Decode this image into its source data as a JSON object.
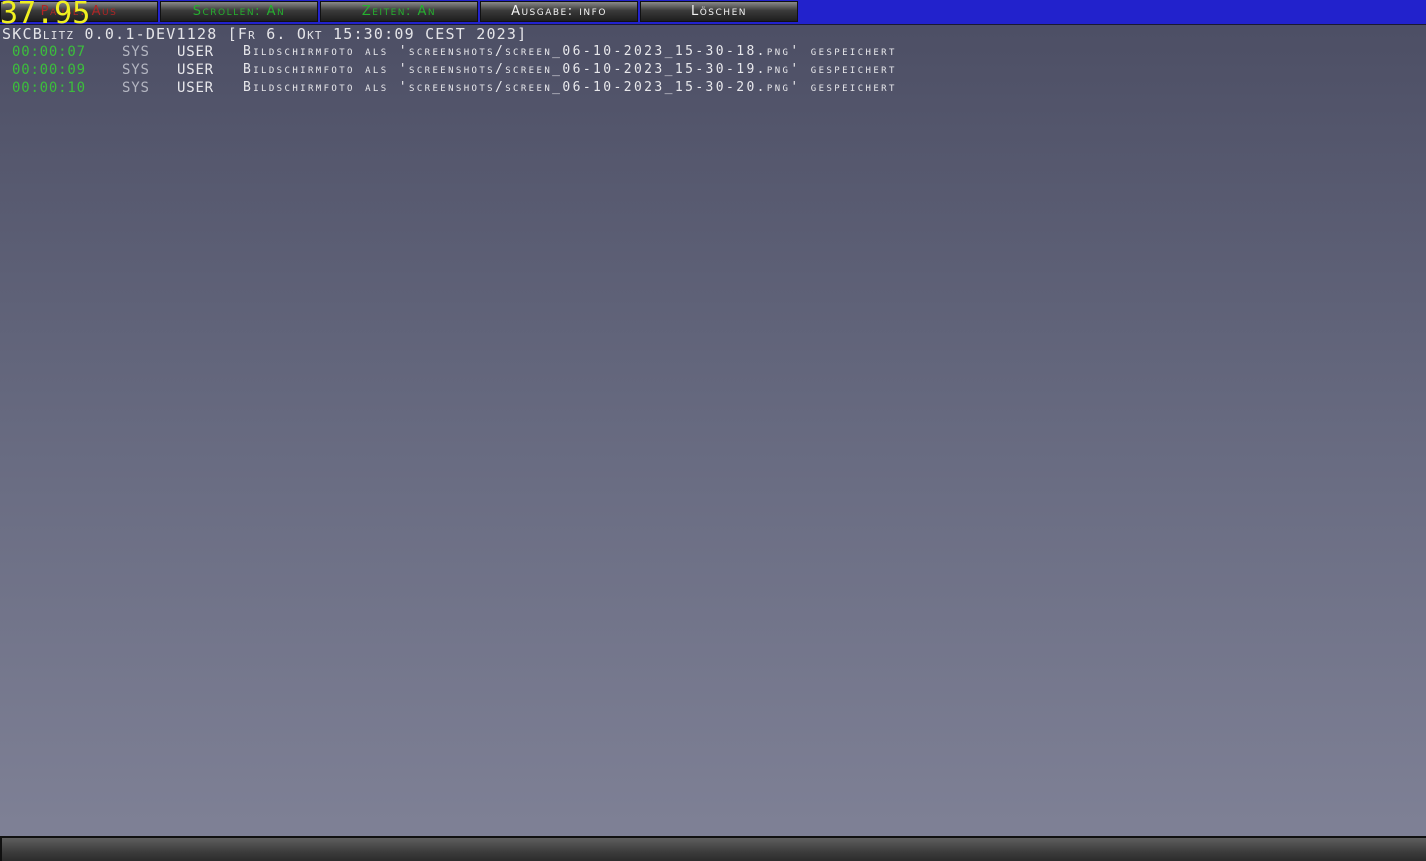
{
  "overlay": {
    "fps": "37.95"
  },
  "toolbar": {
    "pause_label": "Pause: Aus",
    "scroll_label": "Scrollen: An",
    "times_label": "Zeiten: An",
    "output_label": "Ausgabe: info",
    "clear_label": "Löschen"
  },
  "console": {
    "version_line": "SKCBlitz 0.0.1-DEV1128 [Fr 6. Okt 15:30:09 CEST 2023]",
    "entries": [
      {
        "time": "00:00:07",
        "level": "SYS",
        "source": "USER",
        "message": "Bildschirmfoto als 'screenshots/screen_06-10-2023_15-30-18.png' gespeichert"
      },
      {
        "time": "00:00:09",
        "level": "SYS",
        "source": "USER",
        "message": "Bildschirmfoto als 'screenshots/screen_06-10-2023_15-30-19.png' gespeichert"
      },
      {
        "time": "00:00:10",
        "level": "SYS",
        "source": "USER",
        "message": "Bildschirmfoto als 'screenshots/screen_06-10-2023_15-30-20.png' gespeichert"
      }
    ]
  },
  "input": {
    "value": "",
    "placeholder": ""
  },
  "colors": {
    "toolbar_background": "#2222cc",
    "fps_text": "#f0f020",
    "status_off": "#b02626",
    "status_on": "#26b02f",
    "timestamp": "#3cbe3c"
  }
}
